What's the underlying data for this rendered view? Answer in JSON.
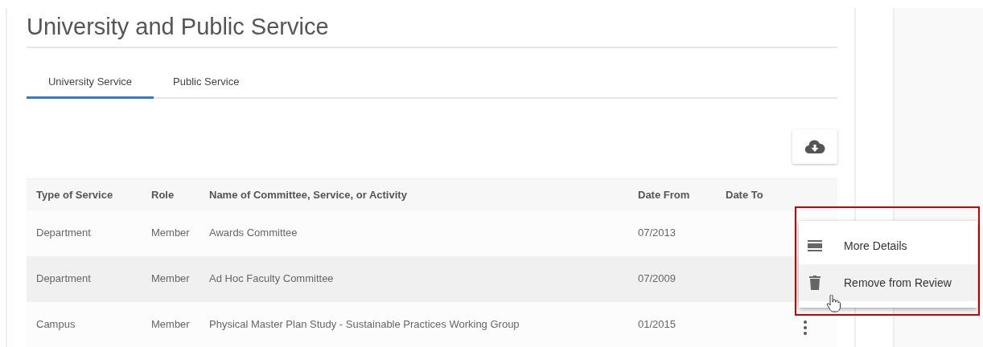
{
  "title": "University and Public Service",
  "tabs": [
    {
      "label": "University Service",
      "selected": true
    },
    {
      "label": "Public Service",
      "selected": false
    }
  ],
  "table": {
    "columns": [
      "Type of Service",
      "Role",
      "Name of Committee, Service, or Activity",
      "Date From",
      "Date To"
    ],
    "rows": [
      {
        "cells": [
          "Department",
          "Member",
          "Awards Committee",
          "07/2013",
          ""
        ],
        "selected": false
      },
      {
        "cells": [
          "Department",
          "Member",
          "Ad Hoc Faculty Committee",
          "07/2009",
          ""
        ],
        "selected": true
      },
      {
        "cells": [
          "Campus",
          "Member",
          "Physical Master Plan Study - Sustainable Practices Working Group",
          "01/2015",
          ""
        ],
        "selected": false
      }
    ]
  },
  "menu": {
    "items": [
      {
        "kind": "details",
        "label": "More Details",
        "selected": false
      },
      {
        "kind": "remove",
        "label": "Remove from Review",
        "selected": true
      }
    ]
  }
}
